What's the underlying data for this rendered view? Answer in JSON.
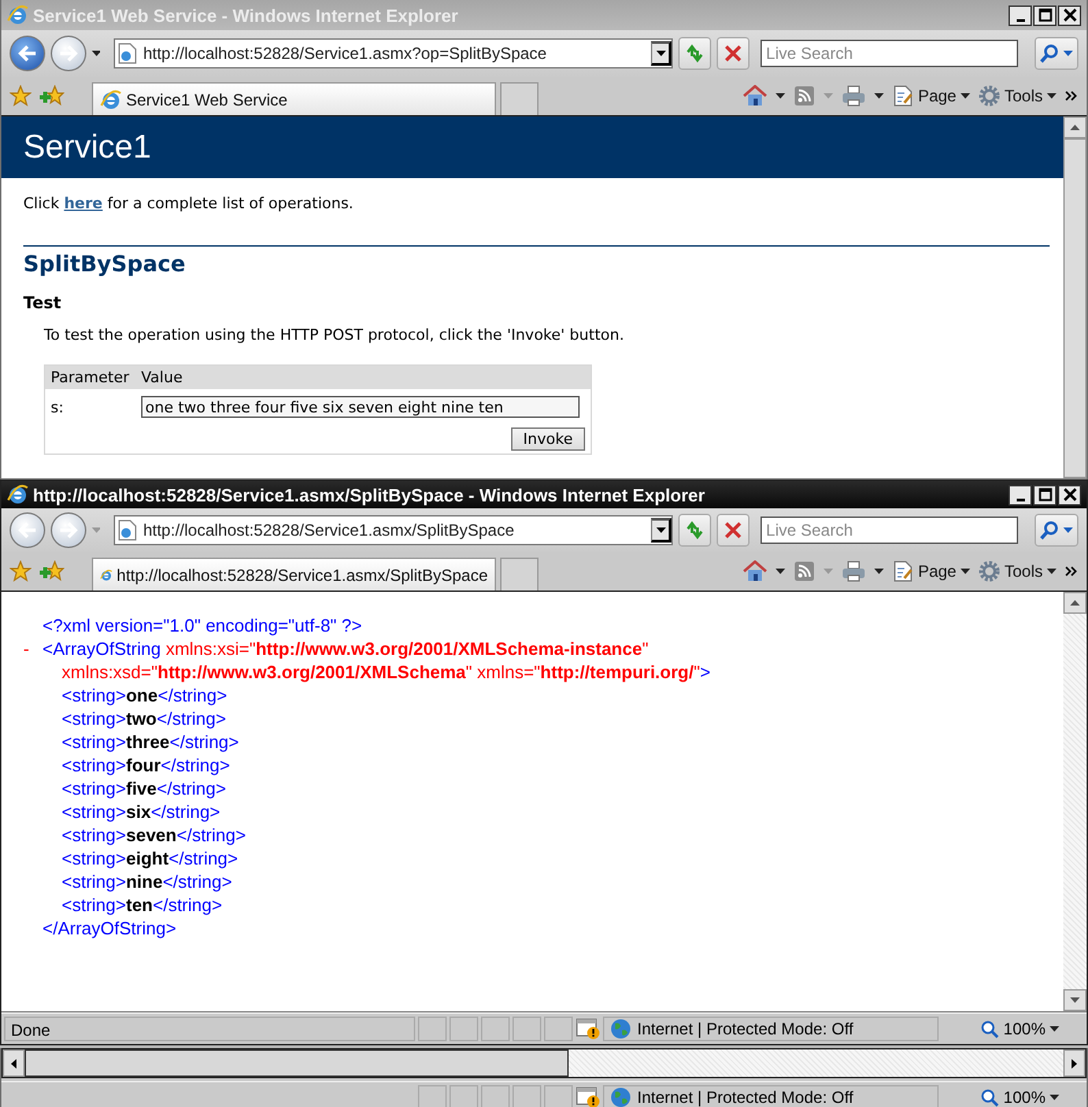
{
  "windows": [
    {
      "title": "Service1 Web Service - Windows Internet Explorer",
      "active": false,
      "back_enabled": true,
      "address": "http://localhost:52828/Service1.asmx?op=SplitBySpace",
      "search": {
        "placeholder": "Live Search"
      },
      "tab_title": "Service1 Web Service",
      "commands": [
        "Page",
        "Tools"
      ],
      "page": {
        "kind": "service-help",
        "header": "Service1",
        "intro": {
          "before": "Click ",
          "link": "here",
          "after": " for a complete list of operations."
        },
        "operation": "SplitBySpace",
        "section": "Test",
        "instruction": "To test the operation using the HTTP POST protocol, click the 'Invoke' button.",
        "table": {
          "columns": [
            "Parameter",
            "Value"
          ],
          "rows": [
            {
              "name": "s:",
              "value": "one two three four five six seven eight nine ten"
            }
          ]
        },
        "button": "Invoke"
      },
      "status": {
        "zone": "Internet | Protected Mode: Off",
        "zoom": "100%"
      }
    },
    {
      "title": "http://localhost:52828/Service1.asmx/SplitBySpace - Windows Internet Explorer",
      "active": true,
      "back_enabled": false,
      "address": "http://localhost:52828/Service1.asmx/SplitBySpace",
      "search": {
        "placeholder": "Live Search"
      },
      "tab_title": "http://localhost:52828/Service1.asmx/SplitBySpace",
      "commands": [
        "Page",
        "Tools"
      ],
      "page": {
        "kind": "xml",
        "declaration": "<?xml version=\"1.0\" encoding=\"utf-8\" ?>",
        "root": {
          "toggle": "-",
          "open_lines": [
            [
              {
                "kind": "tag",
                "text": "<ArrayOfString"
              },
              {
                "kind": "attr",
                "text": " xmlns:xsi=\""
              },
              {
                "kind": "value",
                "text": "http://www.w3.org/2001/XMLSchema-instance"
              },
              {
                "kind": "attr",
                "text": "\""
              }
            ],
            [
              {
                "kind": "attr",
                "text": "xmlns:xsd=\""
              },
              {
                "kind": "value",
                "text": "http://www.w3.org/2001/XMLSchema"
              },
              {
                "kind": "attr",
                "text": "\" xmlns=\""
              },
              {
                "kind": "value",
                "text": "http://tempuri.org/"
              },
              {
                "kind": "attr",
                "text": "\""
              },
              {
                "kind": "tag",
                "text": ">"
              }
            ]
          ],
          "children": [
            {
              "open": "<string>",
              "value": "one",
              "close": "</string>"
            },
            {
              "open": "<string>",
              "value": "two",
              "close": "</string>"
            },
            {
              "open": "<string>",
              "value": "three",
              "close": "</string>"
            },
            {
              "open": "<string>",
              "value": "four",
              "close": "</string>"
            },
            {
              "open": "<string>",
              "value": "five",
              "close": "</string>"
            },
            {
              "open": "<string>",
              "value": "six",
              "close": "</string>"
            },
            {
              "open": "<string>",
              "value": "seven",
              "close": "</string>"
            },
            {
              "open": "<string>",
              "value": "eight",
              "close": "</string>"
            },
            {
              "open": "<string>",
              "value": "nine",
              "close": "</string>"
            },
            {
              "open": "<string>",
              "value": "ten",
              "close": "</string>"
            }
          ],
          "close": "</ArrayOfString>"
        }
      },
      "status": {
        "text": "Done",
        "zone": "Internet | Protected Mode: Off",
        "zoom": "100%"
      }
    }
  ]
}
